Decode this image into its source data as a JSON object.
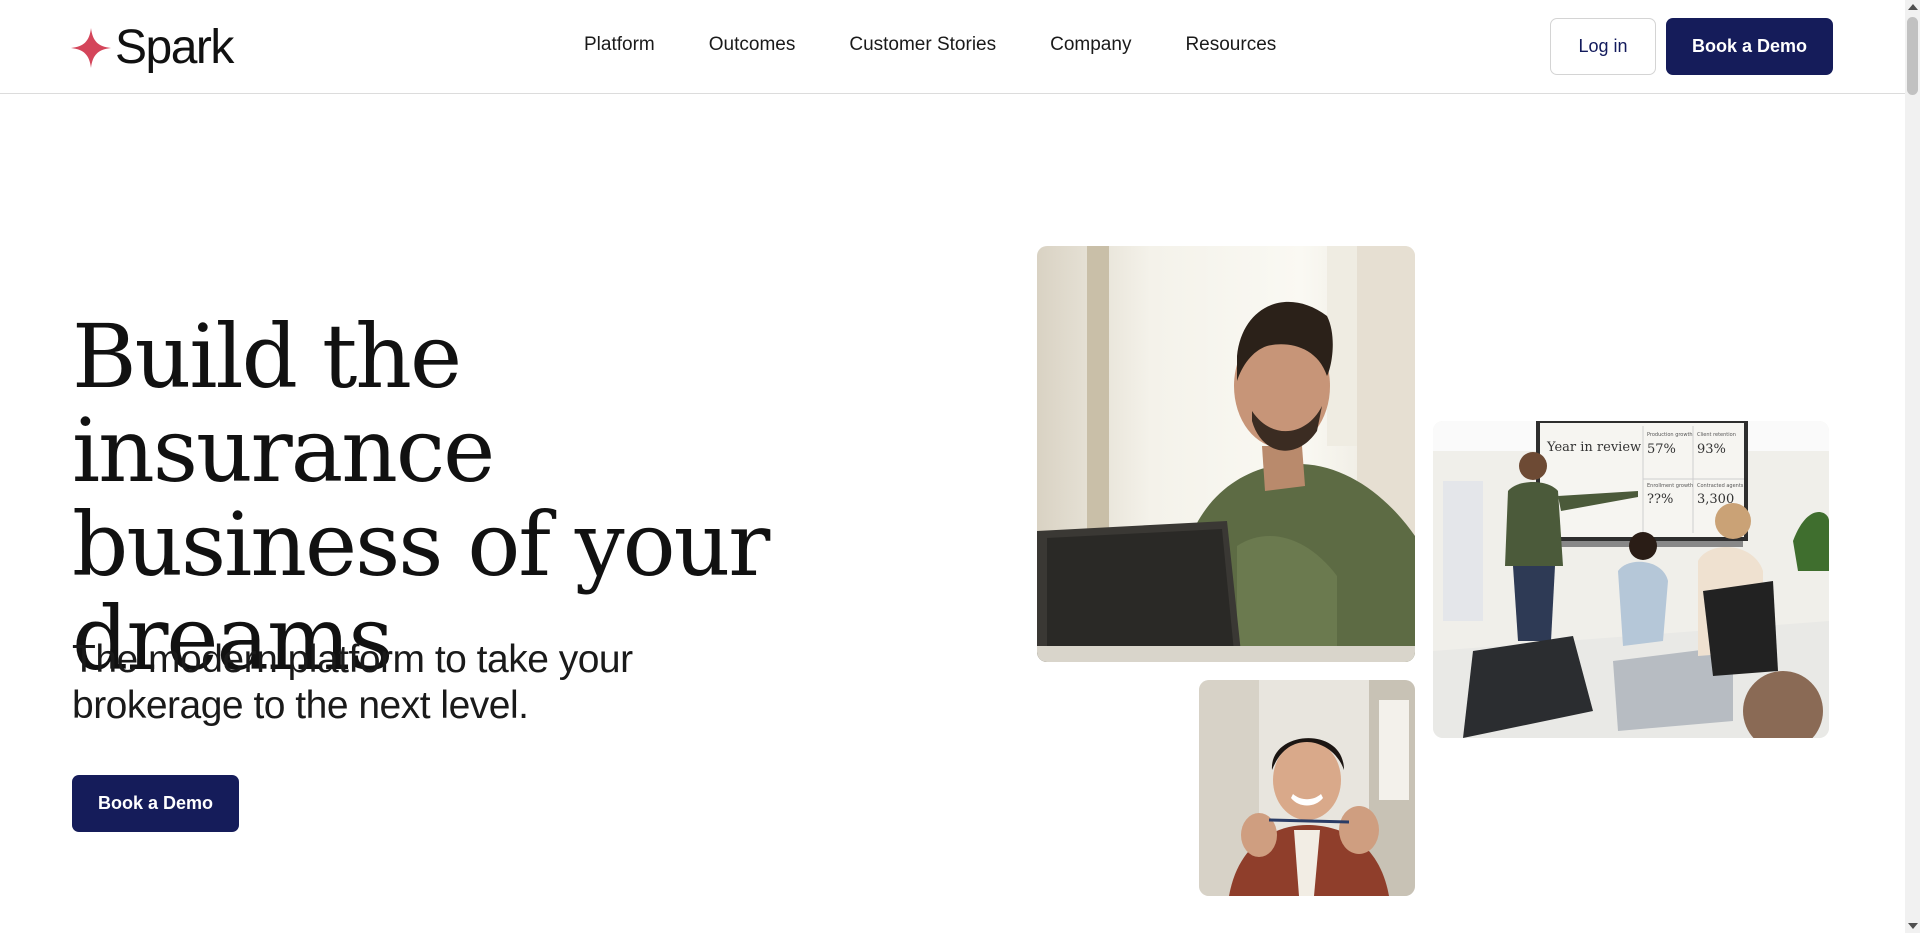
{
  "brand": {
    "name": "Spark",
    "accent_color": "#d4455a",
    "primary_color": "#151c5a",
    "logo_icon": "four-point-star-icon"
  },
  "nav": {
    "items": [
      {
        "label": "Platform"
      },
      {
        "label": "Outcomes"
      },
      {
        "label": "Customer Stories"
      },
      {
        "label": "Company"
      },
      {
        "label": "Resources"
      }
    ]
  },
  "header_actions": {
    "login_label": "Log in",
    "demo_label": "Book a Demo"
  },
  "hero": {
    "title": "Build the insurance business of your dreams",
    "subtitle": "The modern platform to take your brokerage to the next level.",
    "cta_label": "Book a Demo"
  },
  "images": {
    "presentation_screen": {
      "heading": "Year in review",
      "stats": [
        {
          "label": "Production growth",
          "value": "57%"
        },
        {
          "label": "Client retention",
          "value": "93%"
        },
        {
          "label": "Enrollment growth",
          "value": "??%"
        },
        {
          "label": "Contracted agents",
          "value": "3,300"
        }
      ]
    }
  }
}
